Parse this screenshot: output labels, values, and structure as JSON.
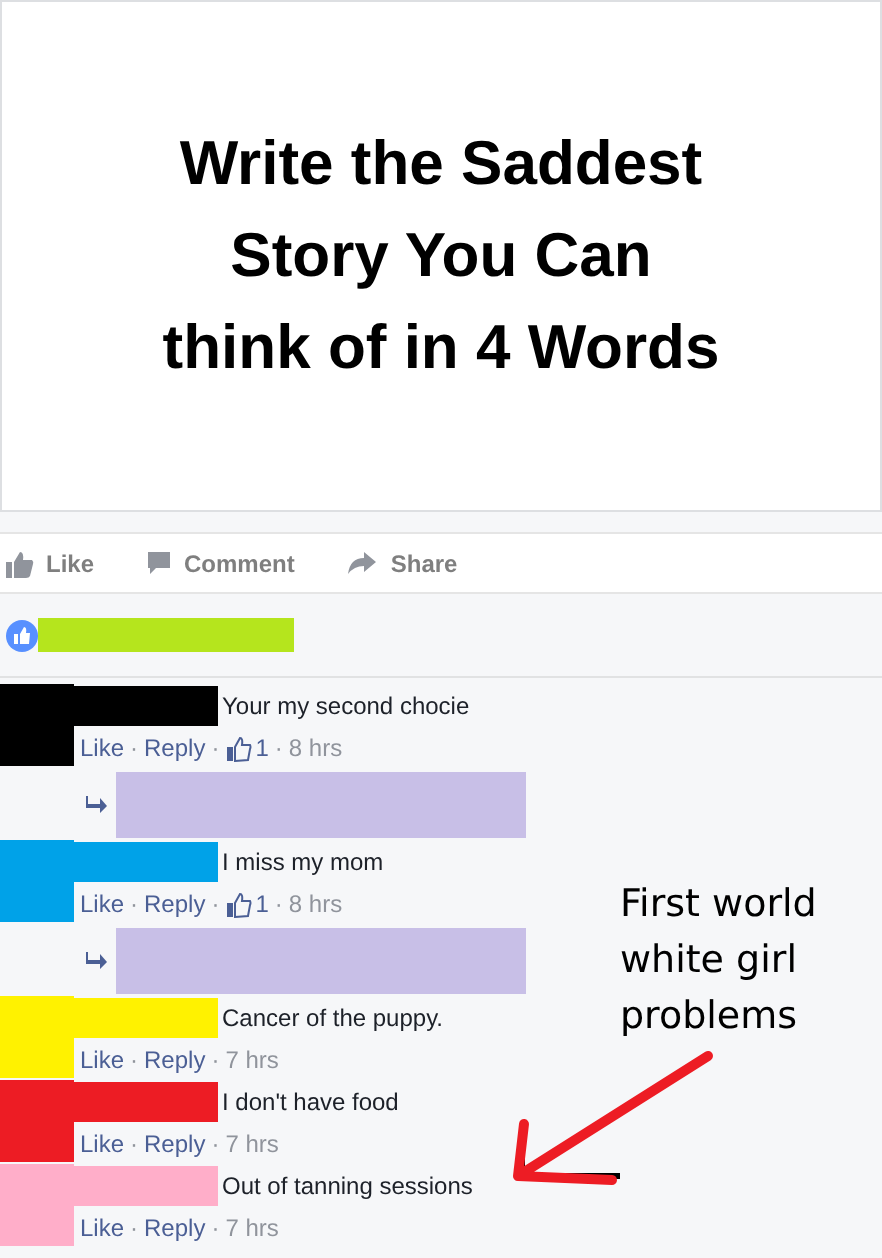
{
  "post": {
    "image_text": "Write the Saddest Story You Can think of in 4 Words"
  },
  "actions": [
    {
      "kind": "like",
      "label": "Like"
    },
    {
      "kind": "comment",
      "label": "Comment"
    },
    {
      "kind": "share",
      "label": "Share"
    }
  ],
  "reactions": {
    "color": "#b5e51d"
  },
  "meta_separator": "·",
  "comments": [
    {
      "color": "#000000",
      "text": "Your my second chocie",
      "meta": [
        {
          "kind": "link",
          "text": "Like"
        },
        {
          "kind": "link",
          "text": "Reply"
        },
        {
          "kind": "likes",
          "text": "1"
        },
        {
          "kind": "time",
          "text": "8 hrs"
        }
      ],
      "replies": [
        {
          "color": "#c8bfe7"
        }
      ]
    },
    {
      "color": "#00a2e8",
      "text": "I miss my mom",
      "meta": [
        {
          "kind": "link",
          "text": "Like"
        },
        {
          "kind": "link",
          "text": "Reply"
        },
        {
          "kind": "likes",
          "text": "1"
        },
        {
          "kind": "time",
          "text": "8 hrs"
        }
      ],
      "replies": [
        {
          "color": "#c8bfe7"
        }
      ]
    },
    {
      "color": "#fff200",
      "text": "Cancer of the puppy.",
      "meta": [
        {
          "kind": "link",
          "text": "Like"
        },
        {
          "kind": "link",
          "text": "Reply"
        },
        {
          "kind": "time",
          "text": "7 hrs"
        }
      ]
    },
    {
      "color": "#ed1c24",
      "text": "I don't have food",
      "meta": [
        {
          "kind": "link",
          "text": "Like"
        },
        {
          "kind": "link",
          "text": "Reply"
        },
        {
          "kind": "time",
          "text": "7 hrs"
        }
      ]
    },
    {
      "color": "#ffaec9",
      "text": "Out of tanning sessions",
      "meta": [
        {
          "kind": "link",
          "text": "Like"
        },
        {
          "kind": "link",
          "text": "Reply"
        },
        {
          "kind": "time",
          "text": "7 hrs"
        }
      ]
    }
  ],
  "annotation": {
    "text": "First world white girl problems"
  }
}
